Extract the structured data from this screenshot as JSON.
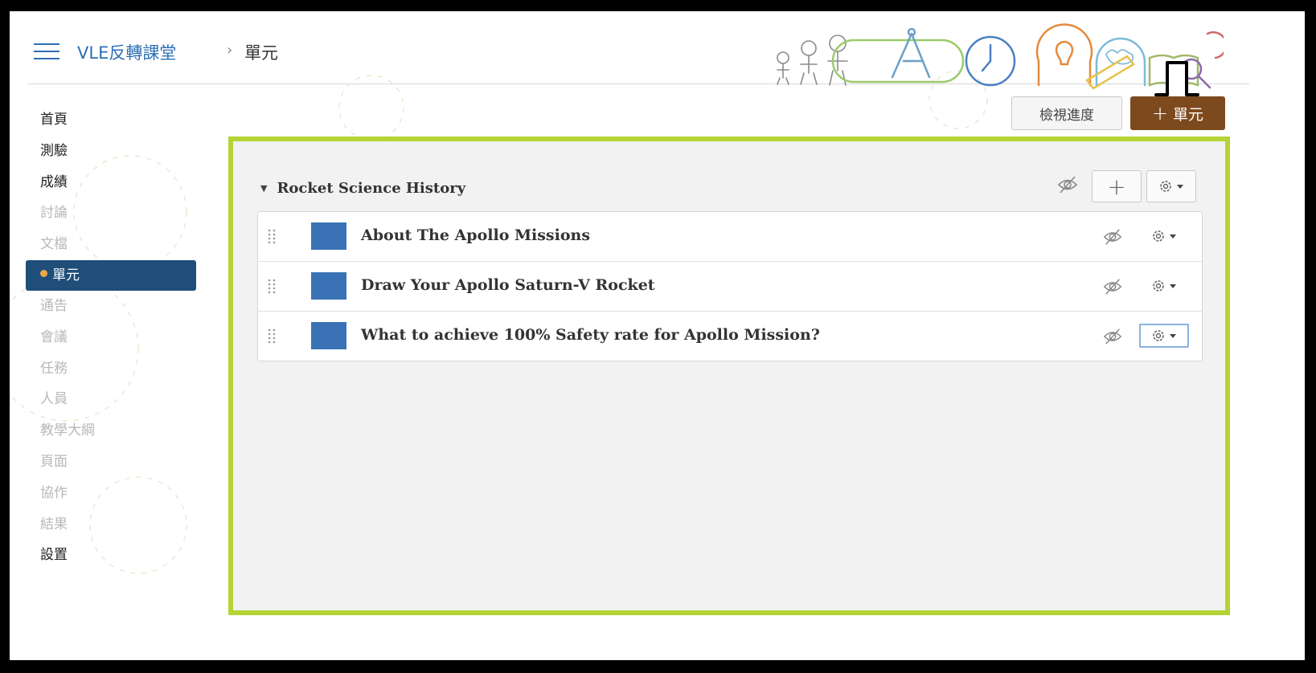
{
  "breadcrumb": {
    "course": "VLE反轉課堂",
    "separator": "›",
    "current": "單元"
  },
  "icons": {
    "menu": "hamburger-menu-icon",
    "banner": "education-doodle-banner",
    "annotation": "down-arrow-icon",
    "hide": "eye-slash-icon",
    "settings": "gear-icon",
    "drag": "drag-handle-icon"
  },
  "toolbar": {
    "view_progress_label": "檢視進度",
    "add_unit_plus": "+",
    "add_unit_label": "單元"
  },
  "sidebar": {
    "items": [
      {
        "label": "首頁",
        "state": "normal"
      },
      {
        "label": "測驗",
        "state": "normal"
      },
      {
        "label": "成績",
        "state": "normal"
      },
      {
        "label": "討論",
        "state": "faded"
      },
      {
        "label": "文檔",
        "state": "faded"
      },
      {
        "label": "單元",
        "state": "active"
      },
      {
        "label": "通告",
        "state": "faded"
      },
      {
        "label": "會議",
        "state": "faded"
      },
      {
        "label": "任務",
        "state": "faded"
      },
      {
        "label": "人員",
        "state": "faded"
      },
      {
        "label": "教學大綱",
        "state": "faded"
      },
      {
        "label": "頁面",
        "state": "faded"
      },
      {
        "label": "協作",
        "state": "faded"
      },
      {
        "label": "結果",
        "state": "faded"
      },
      {
        "label": "設置",
        "state": "normal"
      }
    ]
  },
  "module": {
    "title": "Rocket Science History",
    "add_symbol": "+",
    "items": [
      {
        "title": "About The Apollo Missions"
      },
      {
        "title": "Draw Your Apollo Saturn-V Rocket"
      },
      {
        "title": "What to achieve 100% Safety rate for Apollo Mission?"
      }
    ]
  },
  "colors": {
    "accent_blue": "#2d6fb5",
    "active_nav": "#1f4e79",
    "add_unit_button": "#7d4a1e",
    "panel_border": "#b5d334",
    "item_thumbnail": "#3a73b5"
  }
}
